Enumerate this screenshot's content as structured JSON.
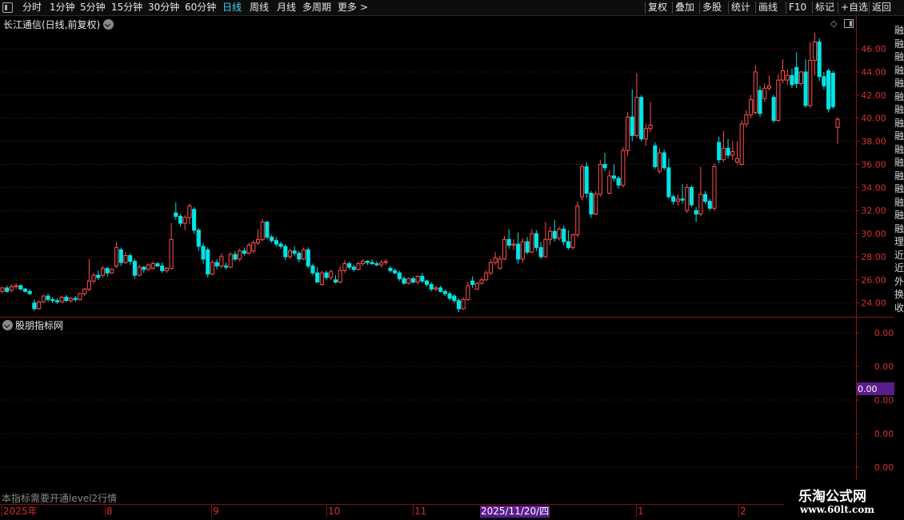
{
  "toolbar": {
    "left": [
      "分时",
      "1分钟",
      "5分钟",
      "15分钟",
      "30分钟",
      "60分钟",
      "日线",
      "周线",
      "月线",
      "多周期",
      "更多"
    ],
    "active": "日线",
    "more_arrow": ">",
    "right": [
      "复权",
      "叠加",
      "多股",
      "统计",
      "画线",
      "F10",
      "标记",
      "+自选",
      "返回"
    ]
  },
  "main_panel": {
    "title": "长江通信(日线,前复权)",
    "price_labels": [
      "46.00",
      "44.00",
      "42.00",
      "40.00",
      "38.00",
      "36.00",
      "34.00",
      "32.00",
      "30.00",
      "28.00",
      "26.00",
      "24.00"
    ]
  },
  "sub_panel": {
    "title": "股朋指标网",
    "value_labels": [
      "0.00",
      "0.00",
      "0.00",
      "0.00",
      "0.00"
    ],
    "current_value": "0.00",
    "notice": "本指标需要开通level2行情"
  },
  "date_axis": {
    "labels": [
      "2025年",
      "8",
      "9",
      "10",
      "11",
      "1",
      "2"
    ],
    "cursor_date": "2025/11/20/四"
  },
  "right_strip": {
    "chars": [
      "融",
      "融",
      "融",
      "融",
      "融",
      "融",
      "融",
      "融",
      "融",
      "融",
      "融",
      "融",
      "融",
      "融",
      "融",
      "融",
      "理",
      "近",
      "近",
      "外",
      "换",
      "收"
    ]
  },
  "watermark": {
    "line1": "乐淘公式网",
    "line2": "www.60lt.com"
  },
  "colors": {
    "up": "#ff4f4f",
    "down": "#00e5e5",
    "grid": "#5a1010",
    "axis_text": "#d23030",
    "cursor_bg": "#5b1c8c"
  },
  "chart_data": {
    "type": "candlestick",
    "ylim": [
      22.8,
      47.6
    ],
    "candles": [
      {
        "o": 25.0,
        "h": 25.4,
        "l": 24.8,
        "c": 25.3
      },
      {
        "o": 25.3,
        "h": 25.5,
        "l": 24.9,
        "c": 25.0
      },
      {
        "o": 25.1,
        "h": 25.6,
        "l": 24.9,
        "c": 25.4
      },
      {
        "o": 25.4,
        "h": 25.7,
        "l": 25.2,
        "c": 25.5
      },
      {
        "o": 25.5,
        "h": 25.6,
        "l": 25.1,
        "c": 25.2
      },
      {
        "o": 25.2,
        "h": 25.3,
        "l": 24.9,
        "c": 25.0
      },
      {
        "o": 25.0,
        "h": 25.2,
        "l": 24.7,
        "c": 24.8
      },
      {
        "o": 24.0,
        "h": 24.3,
        "l": 23.3,
        "c": 23.5
      },
      {
        "o": 23.5,
        "h": 24.2,
        "l": 23.4,
        "c": 24.1
      },
      {
        "o": 24.1,
        "h": 24.7,
        "l": 24.0,
        "c": 24.6
      },
      {
        "o": 24.6,
        "h": 24.8,
        "l": 24.1,
        "c": 24.3
      },
      {
        "o": 24.3,
        "h": 24.5,
        "l": 24.0,
        "c": 24.2
      },
      {
        "o": 24.2,
        "h": 24.4,
        "l": 23.9,
        "c": 24.1
      },
      {
        "o": 24.1,
        "h": 24.6,
        "l": 24.0,
        "c": 24.5
      },
      {
        "o": 24.5,
        "h": 24.7,
        "l": 24.1,
        "c": 24.2
      },
      {
        "o": 24.2,
        "h": 24.5,
        "l": 24.0,
        "c": 24.4
      },
      {
        "o": 24.4,
        "h": 24.6,
        "l": 24.1,
        "c": 24.3
      },
      {
        "o": 24.3,
        "h": 24.9,
        "l": 24.2,
        "c": 24.8
      },
      {
        "o": 24.8,
        "h": 25.3,
        "l": 24.6,
        "c": 25.2
      },
      {
        "o": 25.2,
        "h": 27.8,
        "l": 25.0,
        "c": 25.9
      },
      {
        "o": 25.9,
        "h": 26.6,
        "l": 25.7,
        "c": 26.4
      },
      {
        "o": 26.4,
        "h": 26.8,
        "l": 26.0,
        "c": 26.2
      },
      {
        "o": 26.4,
        "h": 27.2,
        "l": 26.2,
        "c": 27.0
      },
      {
        "o": 27.0,
        "h": 27.1,
        "l": 26.3,
        "c": 26.6
      },
      {
        "o": 26.6,
        "h": 27.0,
        "l": 26.5,
        "c": 26.9
      },
      {
        "o": 27.2,
        "h": 29.3,
        "l": 27.0,
        "c": 28.8
      },
      {
        "o": 28.6,
        "h": 28.8,
        "l": 27.2,
        "c": 27.5
      },
      {
        "o": 27.5,
        "h": 28.4,
        "l": 27.4,
        "c": 28.1
      },
      {
        "o": 28.1,
        "h": 28.3,
        "l": 27.3,
        "c": 27.6
      },
      {
        "o": 27.6,
        "h": 27.8,
        "l": 26.1,
        "c": 26.4
      },
      {
        "o": 26.4,
        "h": 27.3,
        "l": 26.3,
        "c": 27.1
      },
      {
        "o": 27.1,
        "h": 27.2,
        "l": 26.6,
        "c": 26.9
      },
      {
        "o": 26.9,
        "h": 27.4,
        "l": 26.8,
        "c": 27.3
      },
      {
        "o": 27.0,
        "h": 27.6,
        "l": 26.9,
        "c": 27.4
      },
      {
        "o": 27.4,
        "h": 27.5,
        "l": 27.1,
        "c": 27.2
      },
      {
        "o": 27.2,
        "h": 27.5,
        "l": 26.6,
        "c": 26.8
      },
      {
        "o": 26.8,
        "h": 27.1,
        "l": 26.6,
        "c": 27.0
      },
      {
        "o": 27.0,
        "h": 30.9,
        "l": 26.9,
        "c": 29.5
      },
      {
        "o": 31.8,
        "h": 32.7,
        "l": 31.2,
        "c": 31.5
      },
      {
        "o": 31.5,
        "h": 31.7,
        "l": 30.6,
        "c": 30.9
      },
      {
        "o": 30.9,
        "h": 31.6,
        "l": 30.3,
        "c": 31.4
      },
      {
        "o": 31.4,
        "h": 32.6,
        "l": 30.8,
        "c": 32.4
      },
      {
        "o": 32.1,
        "h": 32.3,
        "l": 30.0,
        "c": 30.3
      },
      {
        "o": 30.3,
        "h": 30.5,
        "l": 28.5,
        "c": 28.9
      },
      {
        "o": 28.9,
        "h": 29.2,
        "l": 27.4,
        "c": 27.8
      },
      {
        "o": 28.6,
        "h": 28.8,
        "l": 26.2,
        "c": 26.5
      },
      {
        "o": 26.5,
        "h": 27.7,
        "l": 26.4,
        "c": 27.5
      },
      {
        "o": 27.5,
        "h": 27.8,
        "l": 26.9,
        "c": 27.2
      },
      {
        "o": 27.2,
        "h": 28.3,
        "l": 27.0,
        "c": 28.0
      },
      {
        "o": 27.2,
        "h": 27.5,
        "l": 26.9,
        "c": 27.1
      },
      {
        "o": 27.1,
        "h": 28.4,
        "l": 27.0,
        "c": 28.2
      },
      {
        "o": 28.2,
        "h": 28.5,
        "l": 27.6,
        "c": 27.8
      },
      {
        "o": 27.8,
        "h": 28.7,
        "l": 27.6,
        "c": 28.5
      },
      {
        "o": 28.5,
        "h": 28.8,
        "l": 28.1,
        "c": 28.3
      },
      {
        "o": 28.3,
        "h": 29.2,
        "l": 28.2,
        "c": 29.0
      },
      {
        "o": 28.5,
        "h": 29.4,
        "l": 28.3,
        "c": 29.2
      },
      {
        "o": 29.2,
        "h": 30.4,
        "l": 29.0,
        "c": 29.5
      },
      {
        "o": 29.5,
        "h": 31.3,
        "l": 29.3,
        "c": 31.0
      },
      {
        "o": 31.0,
        "h": 31.1,
        "l": 29.5,
        "c": 29.7
      },
      {
        "o": 29.7,
        "h": 29.9,
        "l": 29.2,
        "c": 29.4
      },
      {
        "o": 29.4,
        "h": 29.7,
        "l": 28.9,
        "c": 29.1
      },
      {
        "o": 29.1,
        "h": 29.3,
        "l": 28.7,
        "c": 28.9
      },
      {
        "o": 28.9,
        "h": 29.1,
        "l": 27.7,
        "c": 28.0
      },
      {
        "o": 28.0,
        "h": 28.7,
        "l": 27.8,
        "c": 28.5
      },
      {
        "o": 28.5,
        "h": 28.9,
        "l": 28.1,
        "c": 28.3
      },
      {
        "o": 28.3,
        "h": 28.5,
        "l": 27.5,
        "c": 27.8
      },
      {
        "o": 27.8,
        "h": 28.8,
        "l": 27.7,
        "c": 28.6
      },
      {
        "o": 28.6,
        "h": 28.8,
        "l": 27.0,
        "c": 27.2
      },
      {
        "o": 27.2,
        "h": 27.4,
        "l": 26.4,
        "c": 26.6
      },
      {
        "o": 26.6,
        "h": 27.1,
        "l": 26.0,
        "c": 25.8
      },
      {
        "o": 25.6,
        "h": 26.8,
        "l": 25.5,
        "c": 26.6
      },
      {
        "o": 26.6,
        "h": 26.8,
        "l": 26.0,
        "c": 26.2
      },
      {
        "o": 26.2,
        "h": 26.9,
        "l": 26.0,
        "c": 26.7
      },
      {
        "o": 26.0,
        "h": 26.4,
        "l": 25.7,
        "c": 25.8
      },
      {
        "o": 25.8,
        "h": 27.2,
        "l": 25.7,
        "c": 26.8
      },
      {
        "o": 26.8,
        "h": 27.7,
        "l": 26.6,
        "c": 27.4
      },
      {
        "o": 27.4,
        "h": 27.6,
        "l": 26.9,
        "c": 27.1
      },
      {
        "o": 27.1,
        "h": 27.3,
        "l": 26.7,
        "c": 26.9
      },
      {
        "o": 26.9,
        "h": 27.6,
        "l": 26.8,
        "c": 27.4
      },
      {
        "o": 27.4,
        "h": 27.8,
        "l": 27.2,
        "c": 27.6
      },
      {
        "o": 27.6,
        "h": 27.7,
        "l": 27.3,
        "c": 27.5
      },
      {
        "o": 27.5,
        "h": 27.8,
        "l": 27.3,
        "c": 27.4
      },
      {
        "o": 27.4,
        "h": 27.6,
        "l": 27.2,
        "c": 27.3
      },
      {
        "o": 27.3,
        "h": 27.7,
        "l": 27.1,
        "c": 27.5
      },
      {
        "o": 27.5,
        "h": 27.8,
        "l": 27.3,
        "c": 27.6
      },
      {
        "o": 27.0,
        "h": 27.2,
        "l": 26.6,
        "c": 26.8
      },
      {
        "o": 26.8,
        "h": 27.0,
        "l": 26.5,
        "c": 26.6
      },
      {
        "o": 26.6,
        "h": 26.8,
        "l": 25.9,
        "c": 26.1
      },
      {
        "o": 26.1,
        "h": 26.3,
        "l": 25.6,
        "c": 25.7
      },
      {
        "o": 25.7,
        "h": 26.2,
        "l": 25.6,
        "c": 26.1
      },
      {
        "o": 26.1,
        "h": 26.3,
        "l": 25.7,
        "c": 25.8
      },
      {
        "o": 25.8,
        "h": 26.4,
        "l": 25.6,
        "c": 26.3
      },
      {
        "o": 26.3,
        "h": 26.6,
        "l": 25.7,
        "c": 25.9
      },
      {
        "o": 25.9,
        "h": 26.0,
        "l": 25.4,
        "c": 25.6
      },
      {
        "o": 25.6,
        "h": 25.8,
        "l": 25.0,
        "c": 25.2
      },
      {
        "o": 25.2,
        "h": 25.5,
        "l": 25.0,
        "c": 25.3
      },
      {
        "o": 25.3,
        "h": 25.5,
        "l": 24.9,
        "c": 25.0
      },
      {
        "o": 25.0,
        "h": 25.2,
        "l": 24.6,
        "c": 24.8
      },
      {
        "o": 24.8,
        "h": 25.0,
        "l": 24.2,
        "c": 24.4
      },
      {
        "o": 24.6,
        "h": 24.8,
        "l": 24.0,
        "c": 24.2
      },
      {
        "o": 24.2,
        "h": 24.4,
        "l": 23.2,
        "c": 23.5
      },
      {
        "o": 23.5,
        "h": 24.5,
        "l": 23.4,
        "c": 24.3
      },
      {
        "o": 24.3,
        "h": 25.8,
        "l": 24.2,
        "c": 25.5
      },
      {
        "o": 25.9,
        "h": 26.3,
        "l": 25.3,
        "c": 25.6
      },
      {
        "o": 25.2,
        "h": 25.8,
        "l": 25.1,
        "c": 25.7
      },
      {
        "o": 25.7,
        "h": 26.2,
        "l": 25.6,
        "c": 26.0
      },
      {
        "o": 26.0,
        "h": 26.8,
        "l": 25.9,
        "c": 26.6
      },
      {
        "o": 26.6,
        "h": 27.8,
        "l": 26.4,
        "c": 27.5
      },
      {
        "o": 27.5,
        "h": 28.4,
        "l": 27.3,
        "c": 27.9
      },
      {
        "o": 27.0,
        "h": 28.1,
        "l": 26.9,
        "c": 27.8
      },
      {
        "o": 27.8,
        "h": 29.8,
        "l": 27.7,
        "c": 29.5
      },
      {
        "o": 29.5,
        "h": 30.4,
        "l": 28.7,
        "c": 29.0
      },
      {
        "o": 29.0,
        "h": 29.5,
        "l": 28.6,
        "c": 29.1
      },
      {
        "o": 29.1,
        "h": 30.1,
        "l": 27.4,
        "c": 27.8
      },
      {
        "o": 27.8,
        "h": 29.6,
        "l": 27.5,
        "c": 29.3
      },
      {
        "o": 29.3,
        "h": 29.7,
        "l": 28.2,
        "c": 28.4
      },
      {
        "o": 28.4,
        "h": 30.4,
        "l": 28.3,
        "c": 30.0
      },
      {
        "o": 30.0,
        "h": 30.3,
        "l": 28.5,
        "c": 28.8
      },
      {
        "o": 28.8,
        "h": 29.3,
        "l": 27.8,
        "c": 28.0
      },
      {
        "o": 28.0,
        "h": 31.0,
        "l": 27.9,
        "c": 29.5
      },
      {
        "o": 29.5,
        "h": 30.6,
        "l": 29.0,
        "c": 30.2
      },
      {
        "o": 30.2,
        "h": 31.2,
        "l": 29.3,
        "c": 29.6
      },
      {
        "o": 29.6,
        "h": 30.6,
        "l": 29.4,
        "c": 30.4
      },
      {
        "o": 30.4,
        "h": 30.7,
        "l": 29.0,
        "c": 29.3
      },
      {
        "o": 29.3,
        "h": 30.3,
        "l": 28.6,
        "c": 28.8
      },
      {
        "o": 28.8,
        "h": 30.0,
        "l": 28.6,
        "c": 29.9
      },
      {
        "o": 29.9,
        "h": 32.8,
        "l": 29.7,
        "c": 32.4
      },
      {
        "o": 33.2,
        "h": 36.0,
        "l": 32.9,
        "c": 35.8
      },
      {
        "o": 35.8,
        "h": 36.2,
        "l": 33.1,
        "c": 33.5
      },
      {
        "o": 33.5,
        "h": 33.7,
        "l": 31.4,
        "c": 31.7
      },
      {
        "o": 31.7,
        "h": 33.7,
        "l": 31.6,
        "c": 33.4
      },
      {
        "o": 33.4,
        "h": 36.4,
        "l": 33.2,
        "c": 36.0
      },
      {
        "o": 36.0,
        "h": 37.0,
        "l": 35.4,
        "c": 35.7
      },
      {
        "o": 33.5,
        "h": 35.5,
        "l": 33.4,
        "c": 35.0
      },
      {
        "o": 35.0,
        "h": 36.0,
        "l": 34.5,
        "c": 34.8
      },
      {
        "o": 34.8,
        "h": 35.0,
        "l": 33.9,
        "c": 34.2
      },
      {
        "o": 34.2,
        "h": 37.5,
        "l": 34.0,
        "c": 37.2
      },
      {
        "o": 37.2,
        "h": 40.5,
        "l": 36.7,
        "c": 40.1
      },
      {
        "o": 40.1,
        "h": 42.5,
        "l": 38.0,
        "c": 38.5
      },
      {
        "o": 38.5,
        "h": 43.9,
        "l": 38.3,
        "c": 41.8
      },
      {
        "o": 41.8,
        "h": 42.0,
        "l": 38.0,
        "c": 38.2
      },
      {
        "o": 38.2,
        "h": 39.5,
        "l": 37.6,
        "c": 39.1
      },
      {
        "o": 39.1,
        "h": 41.4,
        "l": 38.8,
        "c": 39.4
      },
      {
        "o": 37.6,
        "h": 37.9,
        "l": 35.6,
        "c": 35.8
      },
      {
        "o": 35.4,
        "h": 37.4,
        "l": 35.2,
        "c": 37.0
      },
      {
        "o": 37.0,
        "h": 37.3,
        "l": 35.5,
        "c": 35.7
      },
      {
        "o": 35.7,
        "h": 36.5,
        "l": 33.0,
        "c": 33.2
      },
      {
        "o": 33.2,
        "h": 33.4,
        "l": 32.5,
        "c": 32.8
      },
      {
        "o": 32.8,
        "h": 33.4,
        "l": 32.4,
        "c": 33.0
      },
      {
        "o": 33.0,
        "h": 34.3,
        "l": 32.6,
        "c": 32.9
      },
      {
        "o": 32.0,
        "h": 34.3,
        "l": 31.8,
        "c": 34.0
      },
      {
        "o": 34.0,
        "h": 34.2,
        "l": 32.3,
        "c": 32.5
      },
      {
        "o": 32.0,
        "h": 32.3,
        "l": 31.0,
        "c": 31.7
      },
      {
        "o": 31.7,
        "h": 35.8,
        "l": 31.5,
        "c": 33.4
      },
      {
        "o": 33.4,
        "h": 33.7,
        "l": 32.6,
        "c": 32.8
      },
      {
        "o": 32.8,
        "h": 33.0,
        "l": 32.0,
        "c": 32.2
      },
      {
        "o": 32.2,
        "h": 36.1,
        "l": 32.0,
        "c": 35.8
      },
      {
        "o": 37.9,
        "h": 38.4,
        "l": 36.1,
        "c": 36.4
      },
      {
        "o": 36.4,
        "h": 38.9,
        "l": 36.2,
        "c": 37.4
      },
      {
        "o": 37.4,
        "h": 38.2,
        "l": 36.5,
        "c": 36.8
      },
      {
        "o": 36.8,
        "h": 38.0,
        "l": 36.4,
        "c": 37.1
      },
      {
        "o": 36.2,
        "h": 38.0,
        "l": 36.0,
        "c": 36.5
      },
      {
        "o": 36.0,
        "h": 39.8,
        "l": 35.9,
        "c": 39.5
      },
      {
        "o": 39.5,
        "h": 40.7,
        "l": 39.2,
        "c": 40.3
      },
      {
        "o": 40.3,
        "h": 42.0,
        "l": 40.0,
        "c": 41.6
      },
      {
        "o": 40.5,
        "h": 44.6,
        "l": 40.3,
        "c": 44.0
      },
      {
        "o": 42.4,
        "h": 42.8,
        "l": 40.1,
        "c": 40.4
      },
      {
        "o": 41.7,
        "h": 43.0,
        "l": 41.4,
        "c": 42.6
      },
      {
        "o": 42.6,
        "h": 43.7,
        "l": 42.4,
        "c": 42.8
      },
      {
        "o": 41.8,
        "h": 42.0,
        "l": 39.6,
        "c": 39.8
      },
      {
        "o": 39.8,
        "h": 43.8,
        "l": 39.7,
        "c": 43.3
      },
      {
        "o": 43.3,
        "h": 45.1,
        "l": 43.0,
        "c": 44.1
      },
      {
        "o": 43.3,
        "h": 44.2,
        "l": 42.9,
        "c": 43.7
      },
      {
        "o": 43.7,
        "h": 44.3,
        "l": 42.6,
        "c": 42.9
      },
      {
        "o": 44.4,
        "h": 45.7,
        "l": 42.6,
        "c": 43.0
      },
      {
        "o": 43.0,
        "h": 44.1,
        "l": 42.8,
        "c": 44.0
      },
      {
        "o": 44.0,
        "h": 45.1,
        "l": 40.9,
        "c": 41.1
      },
      {
        "o": 41.1,
        "h": 46.6,
        "l": 40.9,
        "c": 45.0
      },
      {
        "o": 45.0,
        "h": 47.4,
        "l": 43.7,
        "c": 46.6
      },
      {
        "o": 46.6,
        "h": 46.9,
        "l": 43.2,
        "c": 43.6
      },
      {
        "o": 43.6,
        "h": 44.0,
        "l": 42.5,
        "c": 42.8
      },
      {
        "o": 44.1,
        "h": 44.3,
        "l": 40.5,
        "c": 40.8
      },
      {
        "o": 43.9,
        "h": 44.1,
        "l": 40.8,
        "c": 41.0
      },
      {
        "o": 39.2,
        "h": 40.1,
        "l": 37.8,
        "c": 39.9
      }
    ]
  }
}
